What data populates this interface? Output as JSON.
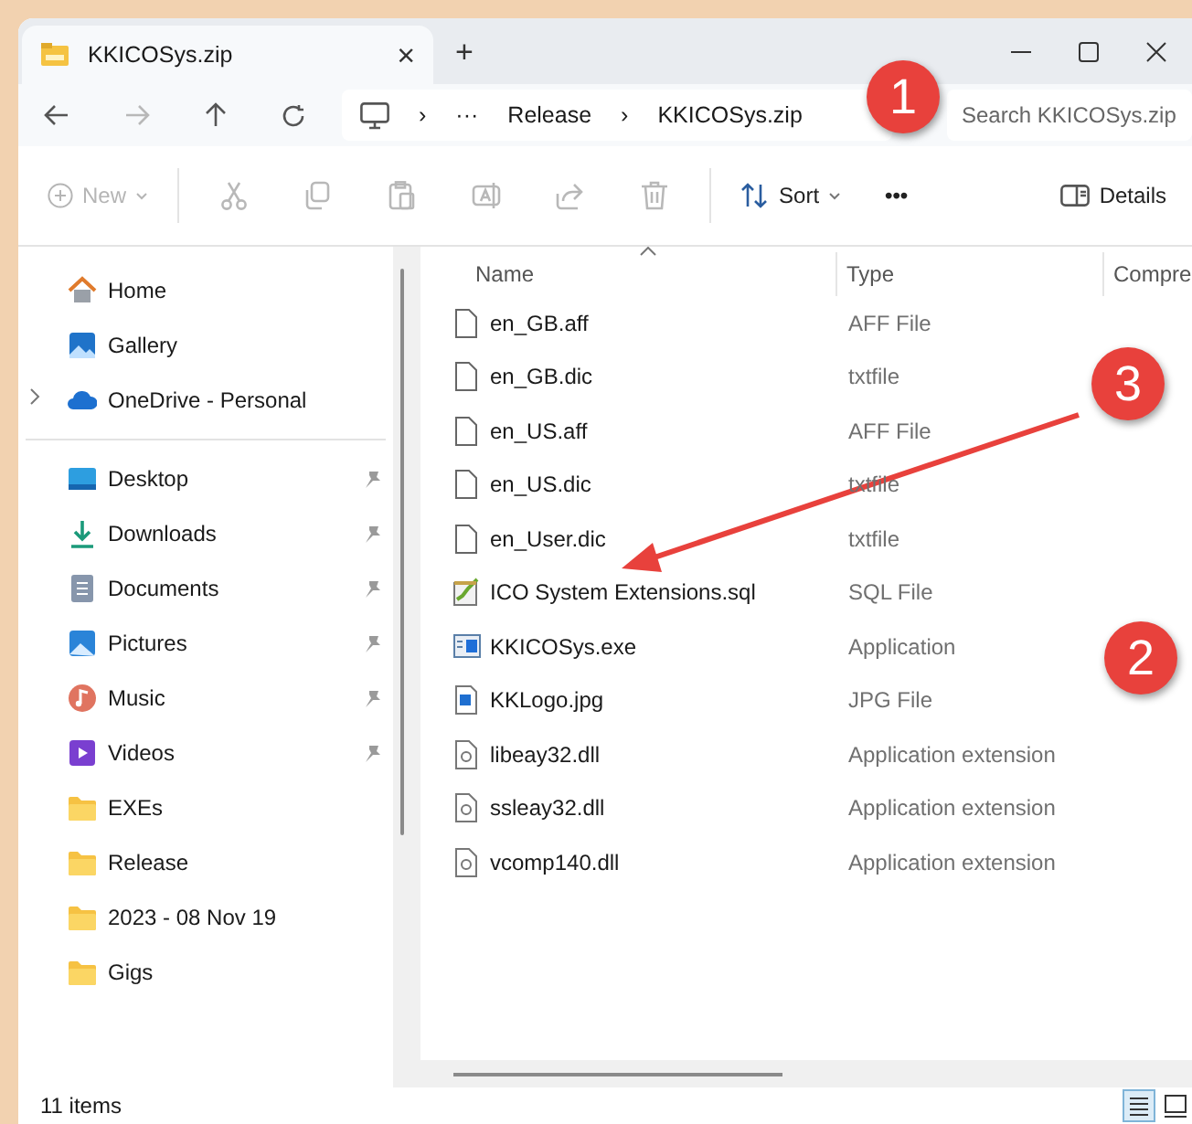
{
  "tab": {
    "title": "KKICOSys.zip",
    "close": "×",
    "new_tab": "+"
  },
  "address": {
    "ellipsis": "···",
    "crumbs": [
      "Release",
      "KKICOSys.zip"
    ],
    "separator": "›"
  },
  "search": {
    "placeholder": "Search KKICOSys.zip"
  },
  "toolbar": {
    "new": {
      "label": "New",
      "disabled": true
    },
    "sort": {
      "label": "Sort"
    },
    "more": "•••",
    "details": {
      "label": "Details"
    }
  },
  "sidebar": {
    "groups": [
      [
        {
          "label": "Home",
          "kind": "home",
          "pinned": false,
          "expandable": false
        },
        {
          "label": "Gallery",
          "kind": "gallery",
          "pinned": false,
          "expandable": false
        },
        {
          "label": "OneDrive - Personal",
          "kind": "cloud",
          "pinned": false,
          "expandable": true
        }
      ],
      [
        {
          "label": "Desktop",
          "kind": "desktop",
          "pinned": true,
          "expandable": false
        },
        {
          "label": "Downloads",
          "kind": "download",
          "pinned": true,
          "expandable": false
        },
        {
          "label": "Documents",
          "kind": "documents",
          "pinned": true,
          "expandable": false
        },
        {
          "label": "Pictures",
          "kind": "pictures",
          "pinned": true,
          "expandable": false
        },
        {
          "label": "Music",
          "kind": "music",
          "pinned": true,
          "expandable": false
        },
        {
          "label": "Videos",
          "kind": "videos",
          "pinned": true,
          "expandable": false
        },
        {
          "label": "EXEs",
          "kind": "folder",
          "pinned": false,
          "expandable": false
        },
        {
          "label": "Release",
          "kind": "folder",
          "pinned": false,
          "expandable": false
        },
        {
          "label": "2023 - 08 Nov 19",
          "kind": "folder",
          "pinned": false,
          "expandable": false
        },
        {
          "label": "Gigs",
          "kind": "folder",
          "pinned": false,
          "expandable": false
        }
      ]
    ]
  },
  "table": {
    "columns": [
      "Name",
      "Type",
      "Compre"
    ],
    "rows": [
      {
        "name": "en_GB.aff",
        "type": "AFF File",
        "kind": "doc"
      },
      {
        "name": "en_GB.dic",
        "type": "txtfile",
        "kind": "doc"
      },
      {
        "name": "en_US.aff",
        "type": "AFF File",
        "kind": "doc"
      },
      {
        "name": "en_US.dic",
        "type": "txtfile",
        "kind": "doc"
      },
      {
        "name": "en_User.dic",
        "type": "txtfile",
        "kind": "doc"
      },
      {
        "name": "ICO System Extensions.sql",
        "type": "SQL File",
        "kind": "sql"
      },
      {
        "name": "KKICOSys.exe",
        "type": "Application",
        "kind": "exe"
      },
      {
        "name": "KKLogo.jpg",
        "type": "JPG File",
        "kind": "jpg"
      },
      {
        "name": "libeay32.dll",
        "type": "Application extension",
        "kind": "dll"
      },
      {
        "name": "ssleay32.dll",
        "type": "Application extension",
        "kind": "dll"
      },
      {
        "name": "vcomp140.dll",
        "type": "Application extension",
        "kind": "dll"
      }
    ]
  },
  "annotations": [
    {
      "number": "1",
      "kind": "badge"
    },
    {
      "number": "2",
      "kind": "badge"
    },
    {
      "number": "3",
      "kind": "badge_arrow"
    }
  ],
  "status_bar": {
    "count": "11 items",
    "views": [
      {
        "kind": "details",
        "selected": true
      },
      {
        "kind": "tiles",
        "selected": false
      }
    ]
  }
}
